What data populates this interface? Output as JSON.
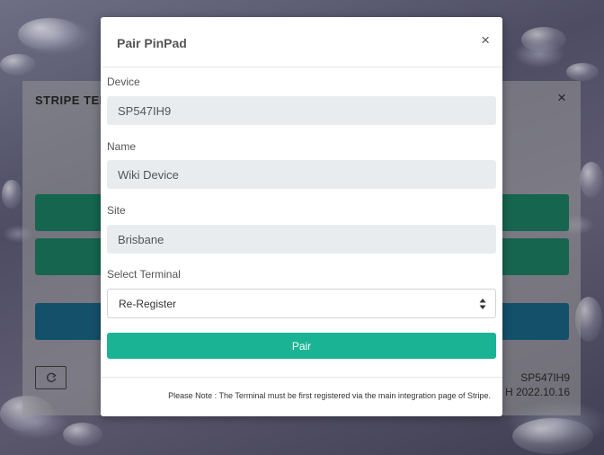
{
  "background_window": {
    "title": "STRIPE TER",
    "device_id": "SP547IH9",
    "version": "H 2022.10.16",
    "colors": {
      "green_button": "#16654f",
      "blue_button": "#15506b"
    }
  },
  "modal": {
    "title": "Pair PinPad",
    "close_glyph": "×",
    "fields": {
      "device": {
        "label": "Device",
        "value": "SP547IH9"
      },
      "name": {
        "label": "Name",
        "value": "Wiki Device"
      },
      "site": {
        "label": "Site",
        "value": "Brisbane"
      }
    },
    "select_terminal": {
      "label": "Select Terminal",
      "selected": "Re-Register"
    },
    "pair_button_label": "Pair",
    "note": "Please Note : The Terminal must be first registered via the main integration page of Stripe.",
    "colors": {
      "accent": "#1ab394"
    }
  }
}
